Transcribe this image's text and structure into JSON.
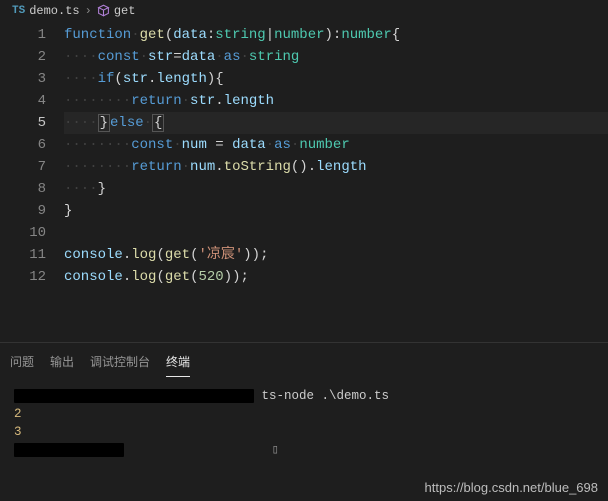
{
  "breadcrumb": {
    "lang_badge": "TS",
    "file": "demo.ts",
    "symbol": "get",
    "symbol_icon": "cube-icon"
  },
  "code": {
    "lines": [
      {
        "n": 1,
        "html": "<span class='kw'>function</span><span class='ws-dot'>·</span><span class='fn'>get</span>(<span class='var'>data</span>:<span class='type'>string</span>|<span class='type'>number</span>):<span class='type'>number</span>{"
      },
      {
        "n": 2,
        "html": "<span class='ws-dot'>····</span><span class='kw'>const</span><span class='ws-dot'>·</span><span class='var'>str</span>=<span class='var'>data</span><span class='ws-dot'>·</span><span class='kw'>as</span><span class='ws-dot'>·</span><span class='type'>string</span>"
      },
      {
        "n": 3,
        "html": "<span class='ws-dot'>····</span><span class='kw'>if</span>(<span class='var'>str</span>.<span class='var'>length</span>){"
      },
      {
        "n": 4,
        "html": "<span class='ws-dot'>········</span><span class='kw'>return</span><span class='ws-dot'>·</span><span class='var'>str</span>.<span class='var'>length</span>"
      },
      {
        "n": 5,
        "current": true,
        "html": "<span class='ws-dot'>····</span><span class='brace-hl'>}</span><span class='kw'>else</span><span class='ws-dot'>·</span><span class='brace-hl'>{</span>"
      },
      {
        "n": 6,
        "html": "<span class='ws-dot'>········</span><span class='kw'>const</span><span class='ws-dot'>·</span><span class='var'>num</span> = <span class='var'>data</span><span class='ws-dot'>·</span><span class='kw'>as</span><span class='ws-dot'>·</span><span class='type'>number</span>"
      },
      {
        "n": 7,
        "html": "<span class='ws-dot'>········</span><span class='kw'>return</span><span class='ws-dot'>·</span><span class='var'>num</span>.<span class='fn'>toString</span>().<span class='var'>length</span>"
      },
      {
        "n": 8,
        "html": "<span class='ws-dot'>····</span>}"
      },
      {
        "n": 9,
        "html": "}"
      },
      {
        "n": 10,
        "html": ""
      },
      {
        "n": 11,
        "html": "<span class='var'>console</span>.<span class='fn'>log</span>(<span class='fn'>get</span>(<span class='str'>'凉宸'</span>));"
      },
      {
        "n": 12,
        "html": "<span class='var'>console</span>.<span class='fn'>log</span>(<span class='fn'>get</span>(<span class='num'>520</span>));"
      }
    ]
  },
  "panel": {
    "tabs": [
      {
        "id": "problems",
        "label": "问题",
        "active": false
      },
      {
        "id": "output",
        "label": "输出",
        "active": false
      },
      {
        "id": "debug",
        "label": "调试控制台",
        "active": false
      },
      {
        "id": "terminal",
        "label": "终端",
        "active": true
      }
    ],
    "terminal": {
      "cmd_suffix": "ts-node .\\demo.ts",
      "output": [
        "2",
        "3"
      ]
    }
  },
  "watermark": "https://blog.csdn.net/blue_698"
}
